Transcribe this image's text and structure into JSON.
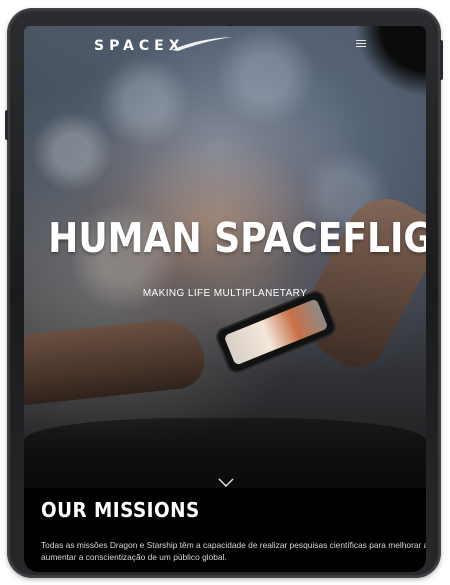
{
  "nav": {
    "logo_text": "SPACEX",
    "menu_icon": "hamburger-menu-icon"
  },
  "hero": {
    "title": "HUMAN SPACEFLIGHT",
    "subtitle": "MAKING LIFE MULTIPLANETARY",
    "scroll_icon": "chevron-down-icon"
  },
  "missions": {
    "title": "OUR MISSIONS",
    "line1": "Todas as missões Dragon e Starship têm a capacidade de realizar pesquisas científicas para melhorar a",
    "line2": "aumentar a conscientização de um público global."
  },
  "colors": {
    "text": "#ffffff",
    "section_bg": "#000000",
    "frame": "#1f2023"
  }
}
